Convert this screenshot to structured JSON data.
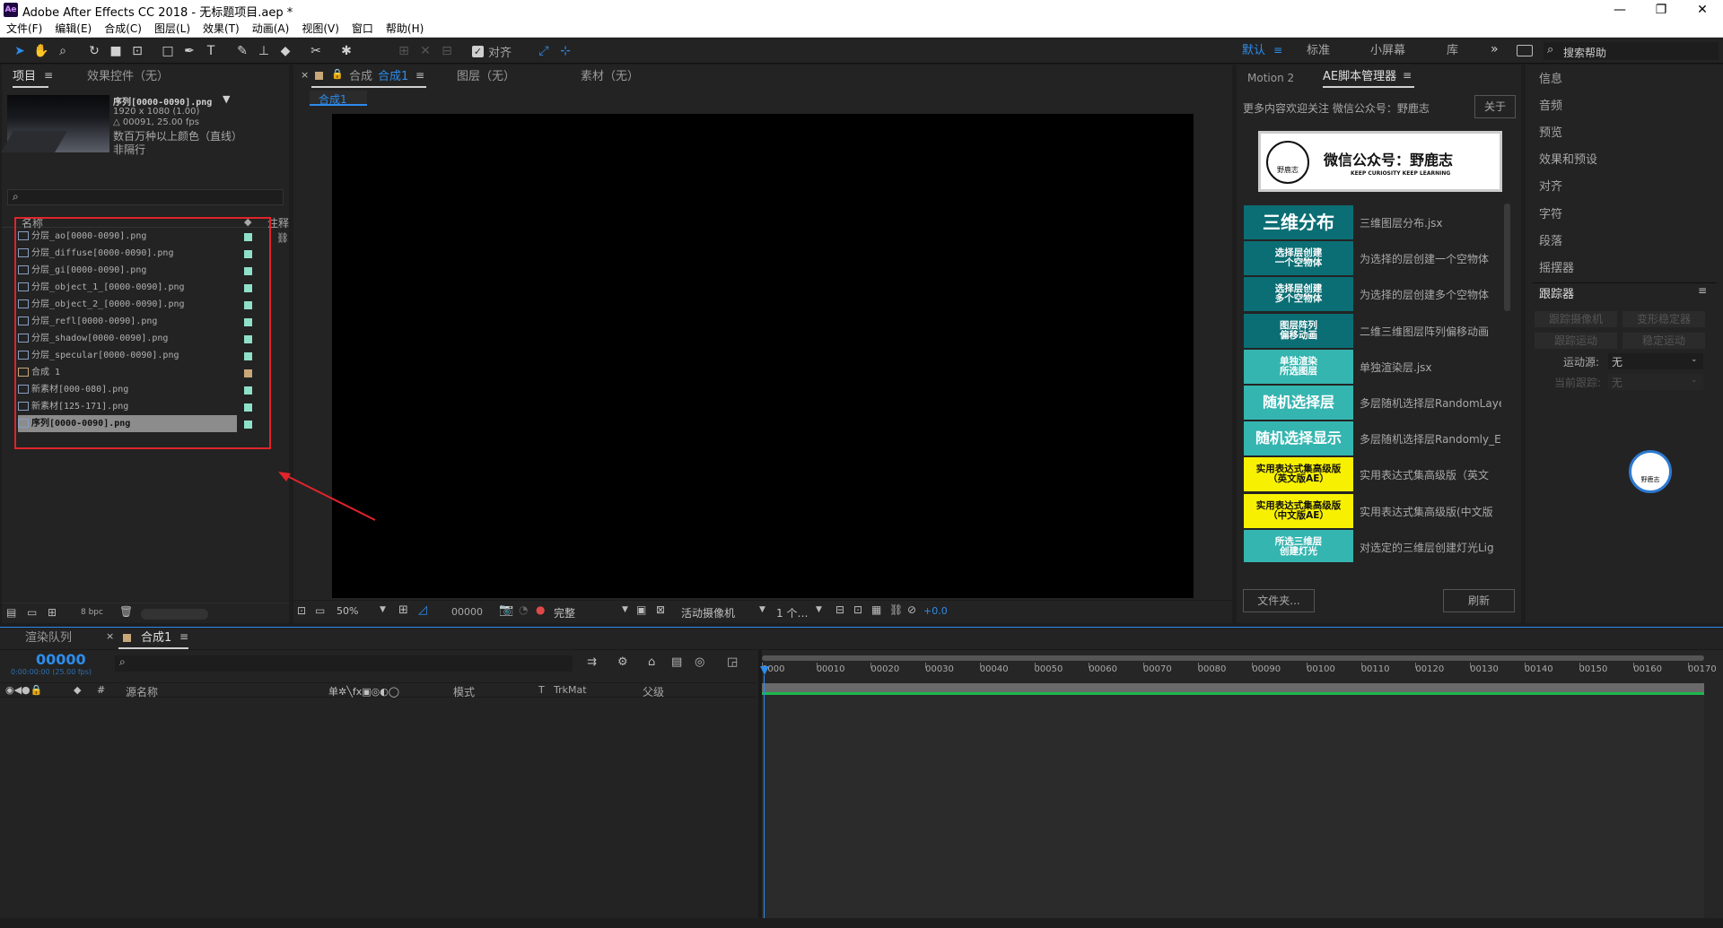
{
  "app": {
    "title": "Adobe After Effects CC 2018 - 无标题项目.aep *",
    "logo": "Ae"
  },
  "menu": [
    "文件(F)",
    "编辑(E)",
    "合成(C)",
    "图层(L)",
    "效果(T)",
    "动画(A)",
    "视图(V)",
    "窗口",
    "帮助(H)"
  ],
  "toolbar": {
    "align_label": "对齐",
    "workspaces": [
      "默认",
      "标准",
      "小屏幕",
      "库"
    ],
    "active_workspace": "默认",
    "search_placeholder": "搜索帮助"
  },
  "project": {
    "tab_project": "项目",
    "tab_effects": "效果控件（无）",
    "selected_name": "序列[0000-0090].png",
    "info_lines": [
      "1920 x 1080 (1.00)",
      "△ 00091, 25.00 fps",
      "数百万种以上颜色（直线）",
      "非隔行"
    ],
    "search_placeholder": "",
    "col_name": "名称",
    "col_note": "注释",
    "files": [
      {
        "name": "分层_ao[0000-0090].png",
        "label": "#8fe0c8"
      },
      {
        "name": "分层_diffuse[0000-0090].png",
        "label": "#8fe0c8"
      },
      {
        "name": "分层_gi[0000-0090].png",
        "label": "#8fe0c8"
      },
      {
        "name": "分层_object_1_[0000-0090].png",
        "label": "#8fe0c8"
      },
      {
        "name": "分层_object_2_[0000-0090].png",
        "label": "#8fe0c8"
      },
      {
        "name": "分层_refl[0000-0090].png",
        "label": "#8fe0c8"
      },
      {
        "name": "分层_shadow[0000-0090].png",
        "label": "#8fe0c8"
      },
      {
        "name": "分层_specular[0000-0090].png",
        "label": "#8fe0c8"
      },
      {
        "name": "合成 1",
        "label": "#c8a878"
      },
      {
        "name": "新素材[000-080].png",
        "label": "#8fe0c8"
      },
      {
        "name": "新素材[125-171].png",
        "label": "#8fe0c8"
      },
      {
        "name": "序列[0000-0090].png",
        "label": "#8fe0c8"
      }
    ],
    "bpc": "8 bpc"
  },
  "viewer": {
    "tab_comp_prefix": "合成",
    "tab_comp": "合成1",
    "tab_layer": "图层（无）",
    "tab_footage": "素材（无）",
    "sub_tab": "合成1",
    "zoom": "50%",
    "timecode": "00000",
    "resolution": "完整",
    "camera": "活动摄像机",
    "views": "1 个…",
    "exposure": "+0.0"
  },
  "script_manager": {
    "tab_motion": "Motion 2",
    "tab_ae": "AE脚本管理器",
    "notice": "更多内容欢迎关注 微信公众号：野鹿志",
    "about": "关于",
    "banner_title": "微信公众号：野鹿志",
    "banner_sub": "KEEP CURIOSITY KEEP LEARNING",
    "banner_logo_text": "野鹿志",
    "scripts": [
      {
        "label": "三维分布",
        "desc": "三维图层分布.jsx",
        "bg": "#0b6e74",
        "fg": "#ffffff"
      },
      {
        "label": "选择层创建\n一个空物体",
        "desc": "为选择的层创建一个空物体",
        "bg": "#0b6e74",
        "fg": "#ffffff"
      },
      {
        "label": "选择层创建\n多个空物体",
        "desc": "为选择的层创建多个空物体",
        "bg": "#0b6e74",
        "fg": "#ffffff"
      },
      {
        "label": "图层阵列\n偏移动画",
        "desc": "二维三维图层阵列偏移动画",
        "bg": "#0b6e74",
        "fg": "#ffffff"
      },
      {
        "label": "单独渲染\n所选图层",
        "desc": "单独渲染层.jsx",
        "bg": "#35b5b0",
        "fg": "#ffffff"
      },
      {
        "label": "随机选择层",
        "desc": "多层随机选择层RandomLayer",
        "bg": "#35b5b0",
        "fg": "#ffffff"
      },
      {
        "label": "随机选择显示",
        "desc": "多层随机选择层Randomly_En",
        "bg": "#35b5b0",
        "fg": "#ffffff"
      },
      {
        "label": "实用表达式集高级版\n（英文版AE）",
        "desc": "实用表达式集高级版（英文",
        "bg": "#f7f000",
        "fg": "#111111"
      },
      {
        "label": "实用表达式集高级版\n（中文版AE）",
        "desc": "实用表达式集高级版(中文版",
        "bg": "#f7f000",
        "fg": "#111111"
      },
      {
        "label": "所选三维层\n创建灯光",
        "desc": "对选定的三维层创建灯光Lig",
        "bg": "#35b5b0",
        "fg": "#ffffff"
      }
    ],
    "folder_btn": "文件夹...",
    "refresh_btn": "刷新"
  },
  "right_panels": {
    "items": [
      "信息",
      "音频",
      "预览",
      "效果和预设",
      "对齐",
      "字符",
      "段落",
      "摇摆器"
    ],
    "tracker_title": "跟踪器",
    "tracker_buttons": [
      "跟踪摄像机",
      "变形稳定器",
      "跟踪运动",
      "稳定运动"
    ],
    "motion_source_label": "运动源:",
    "motion_source_value": "无",
    "current_track_label": "当前跟踪:",
    "current_track_value": "无",
    "float_logo_text": "野鹿志"
  },
  "timeline": {
    "tab_render": "渲染队列",
    "tab_comp": "合成1",
    "timecode": "00000",
    "fps_info": "0:00:00:00 (25.00 fps)",
    "search_placeholder": "",
    "col_source": "源名称",
    "col_mode": "模式",
    "col_t": "T",
    "col_trkmat": "TrkMat",
    "col_parent": "父级",
    "ruler": [
      "0000",
      "00010",
      "00020",
      "00030",
      "00040",
      "00050",
      "00060",
      "00070",
      "00080",
      "00090",
      "00100",
      "00110",
      "00120",
      "00130",
      "00140",
      "00150",
      "00160",
      "00170"
    ]
  },
  "colors": {
    "accent": "#2d8ceb",
    "highlight_box": "#e0242a",
    "arrow": "#e0242a",
    "panel_bg": "#232323",
    "workspace_active": "#2d8ceb"
  }
}
